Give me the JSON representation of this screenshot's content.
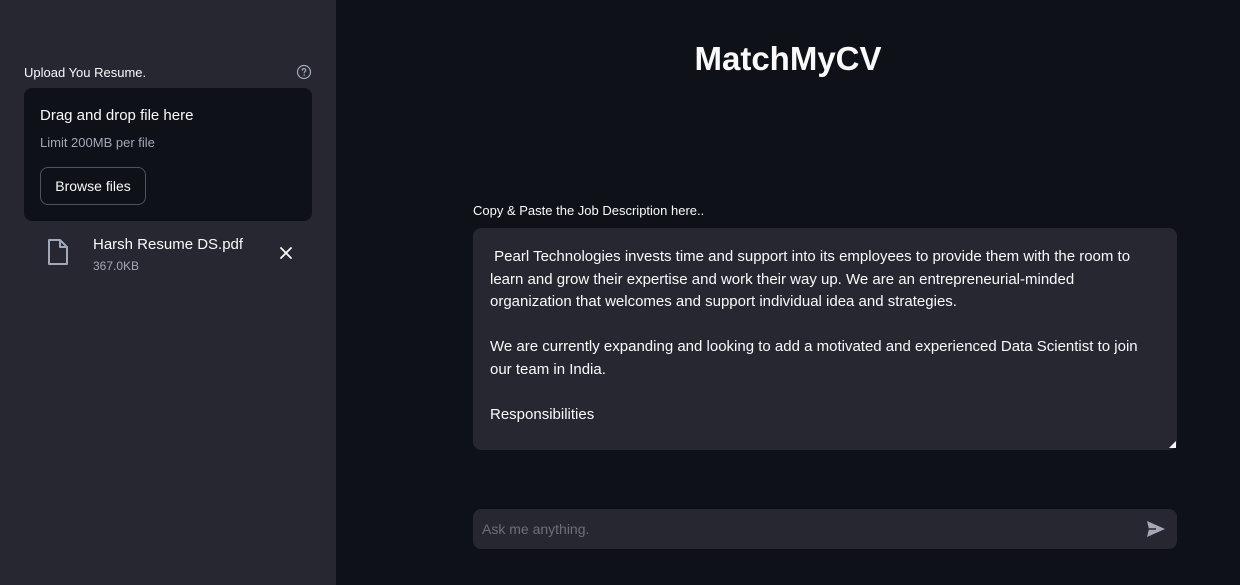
{
  "sidebar": {
    "upload_label": "Upload You Resume.",
    "dropzone": {
      "title": "Drag and drop file here",
      "limit": "Limit 200MB per file",
      "browse_label": "Browse files"
    },
    "uploaded_file": {
      "name": "Harsh Resume DS.pdf",
      "size": "367.0KB"
    },
    "icons": {
      "help": "help-circle-icon",
      "file": "file-icon",
      "remove": "close-icon"
    }
  },
  "main": {
    "title": "MatchMyCV",
    "job_description": {
      "label": "Copy & Paste the Job Description here..",
      "value": " Pearl Technologies invests time and support into its employees to provide them with the room to learn and grow their expertise and work their way up. We are an entrepreneurial-minded organization that welcomes and support individual idea and strategies.\n\nWe are currently expanding and looking to add a motivated and experienced Data Scientist to join our team in India.\n\nResponsibilities"
    },
    "chat": {
      "placeholder": "Ask me anything.",
      "send_icon": "send-icon"
    }
  },
  "colors": {
    "background": "#0e1117",
    "sidebar": "#262730",
    "text": "#fafafa",
    "muted": "#a3a8b8"
  }
}
